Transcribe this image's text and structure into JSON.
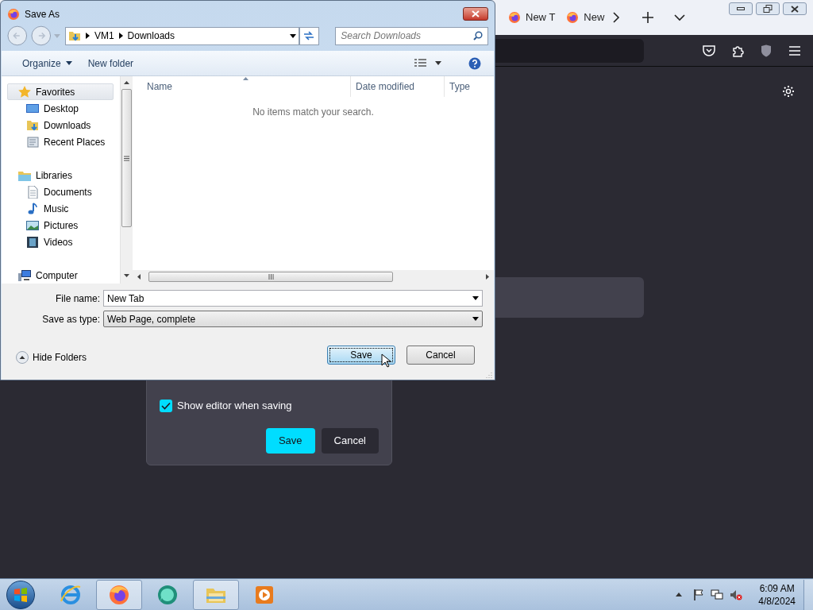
{
  "browser": {
    "tabs": [
      {
        "label": "New T"
      },
      {
        "label": "New"
      }
    ],
    "editor_panel": {
      "checkbox": {
        "label": "Show editor when saving",
        "checked": true
      },
      "buttons": [
        {
          "label": "Save",
          "kind": "primary"
        },
        {
          "label": "Cancel",
          "kind": "secondary"
        }
      ]
    }
  },
  "dialog": {
    "title": "Save As",
    "breadcrumb": [
      "VM1",
      "Downloads"
    ],
    "search": {
      "placeholder": "Search Downloads"
    },
    "toolbar": [
      "Organize",
      "New folder"
    ],
    "nav": [
      {
        "label": "Favorites",
        "kind": "star",
        "selected": true,
        "children": [
          {
            "label": "Desktop",
            "kind": "desktop",
            "selected": false
          },
          {
            "label": "Downloads",
            "kind": "download",
            "selected": false
          },
          {
            "label": "Recent Places",
            "kind": "recent",
            "selected": false
          }
        ]
      },
      {
        "label": "Libraries",
        "kind": "library",
        "selected": false,
        "children": [
          {
            "label": "Documents",
            "kind": "document",
            "selected": false
          },
          {
            "label": "Music",
            "kind": "music",
            "selected": false
          },
          {
            "label": "Pictures",
            "kind": "pictures",
            "selected": false
          },
          {
            "label": "Videos",
            "kind": "videos",
            "selected": false
          }
        ]
      },
      {
        "label": "Computer",
        "kind": "computer",
        "selected": false
      }
    ],
    "columns": [
      "Name",
      "Date modified",
      "Type"
    ],
    "empty_message": "No items match your search.",
    "file_name": {
      "label": "File name:",
      "value": "New Tab"
    },
    "save_as_type": {
      "label": "Save as type:",
      "value": "Web Page, complete"
    },
    "hide_folders": "Hide Folders",
    "buttons": [
      {
        "label": "Save",
        "kind": "default"
      },
      {
        "label": "Cancel",
        "kind": "normal"
      }
    ]
  },
  "taskbar": {
    "apps": [
      {
        "kind": "ie",
        "selected": false
      },
      {
        "kind": "firefox",
        "selected": true
      },
      {
        "kind": "chat",
        "selected": false
      },
      {
        "kind": "explorer",
        "selected": true
      },
      {
        "kind": "media",
        "selected": false
      }
    ],
    "time": "6:09 AM",
    "date": "4/8/2024"
  }
}
